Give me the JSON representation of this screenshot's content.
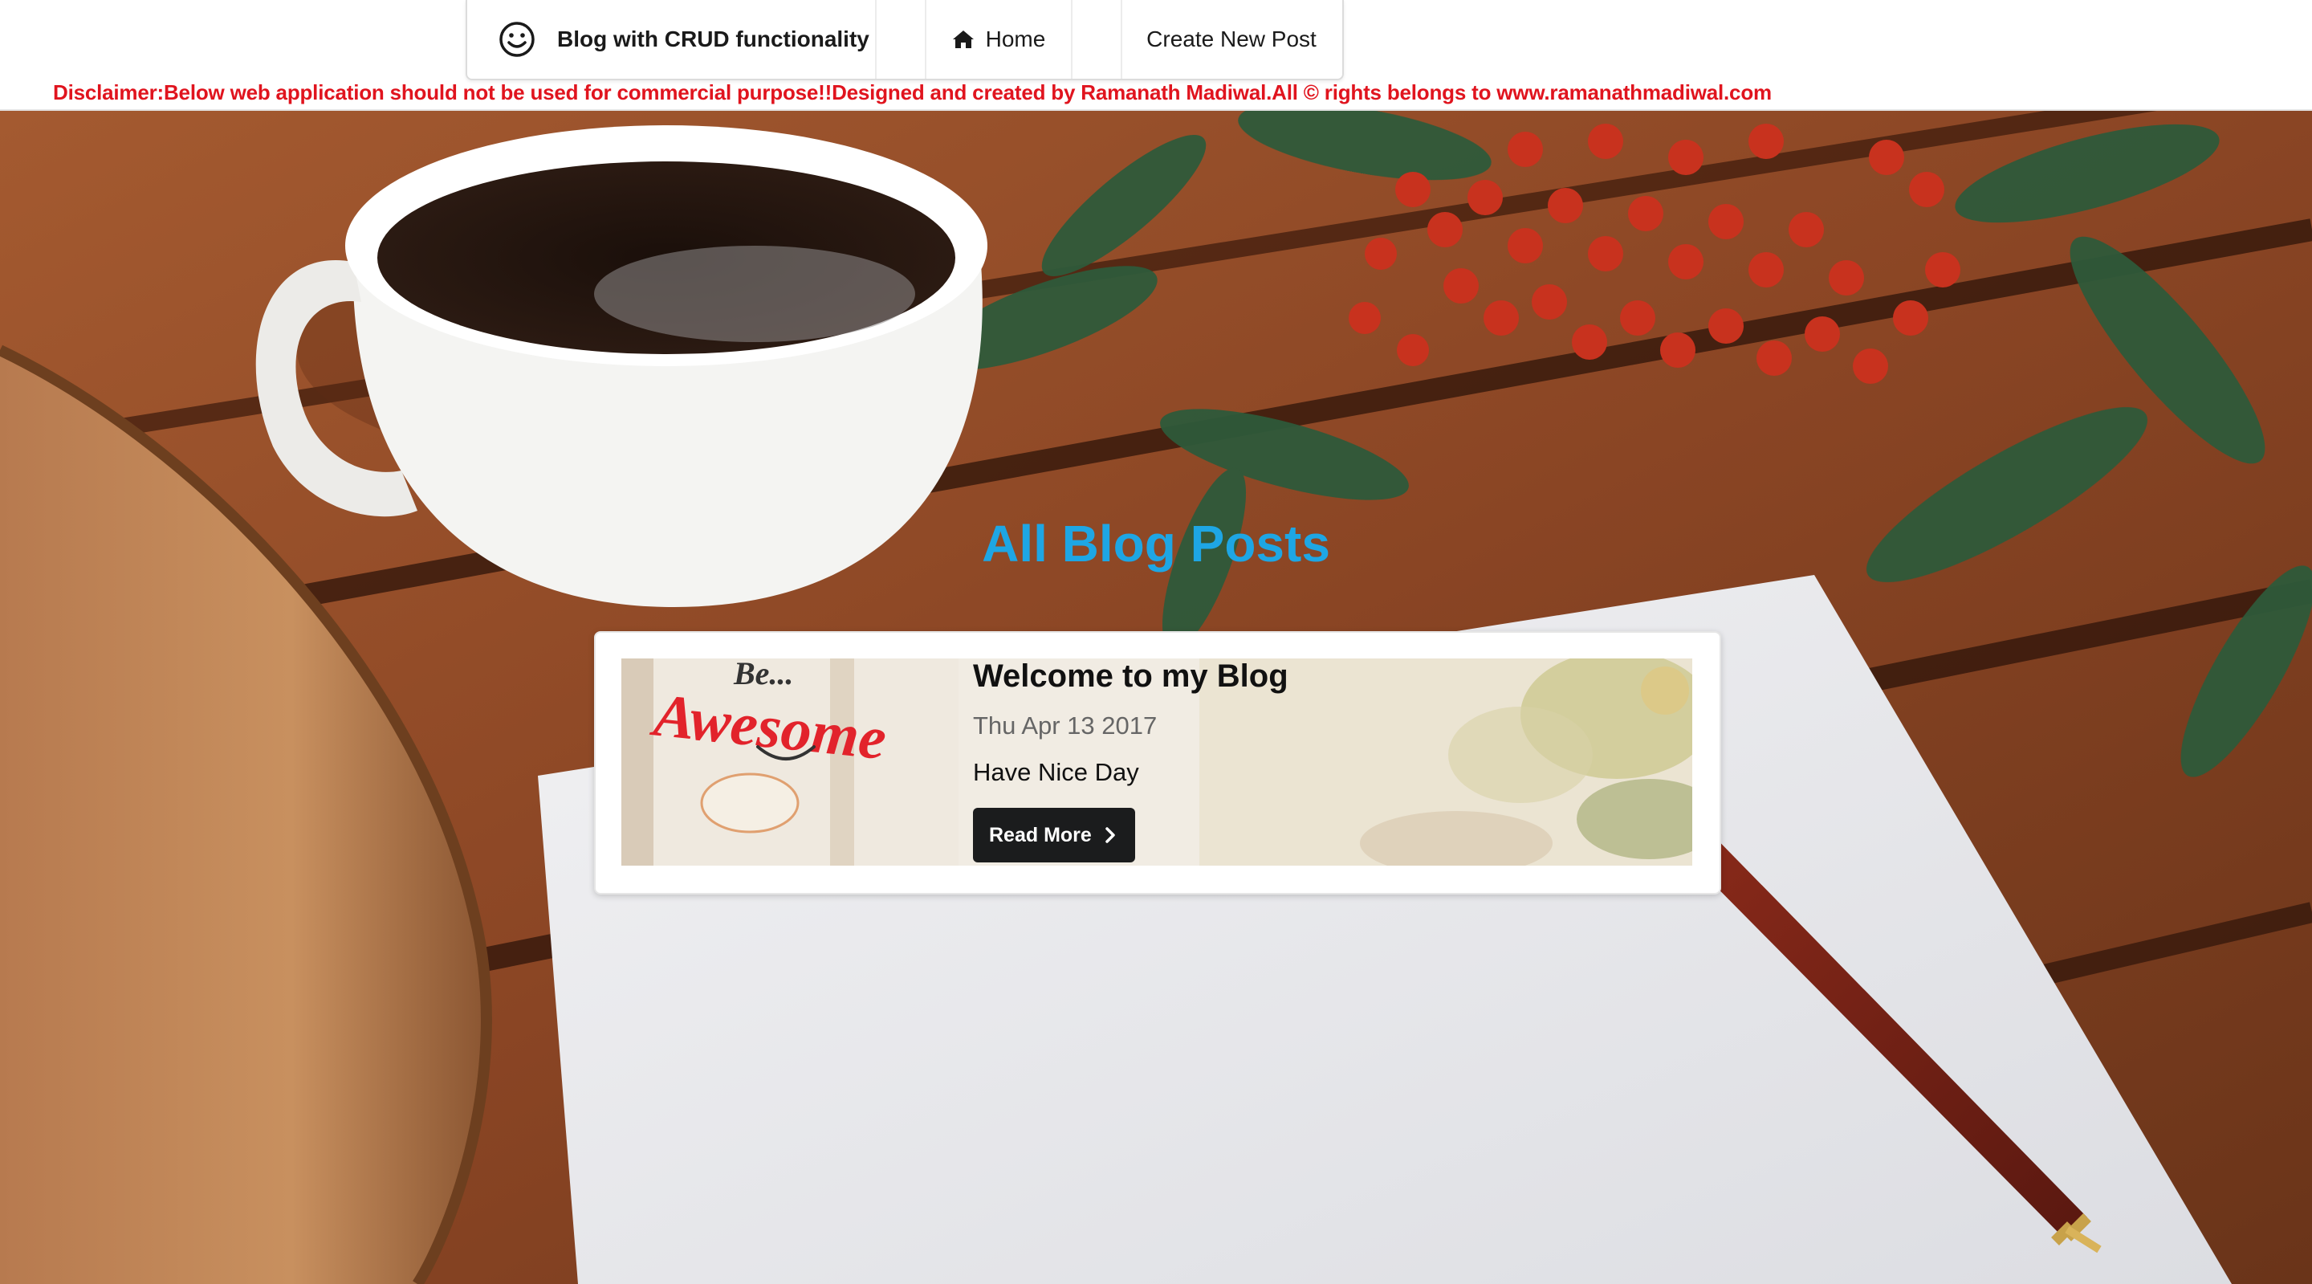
{
  "header": {
    "brand_label": "Blog with CRUD functionality",
    "nav": {
      "home_label": "Home",
      "create_label": "Create New Post"
    },
    "disclaimer": "Disclaimer:Below web application should not be used for commercial purpose!!Designed and created by Ramanath Madiwal.All © rights belongs to www.ramanathmadiwal.com"
  },
  "main": {
    "title": "All Blog Posts",
    "posts": [
      {
        "title": "Welcome to my Blog",
        "date": "Thu Apr 13 2017",
        "description": "Have Nice Day",
        "read_more_label": "Read More",
        "thumbnail_text": {
          "top": "Be...",
          "main": "Awesome"
        }
      }
    ]
  },
  "icons": {
    "brand": "smile-icon",
    "home": "home-icon",
    "read_more": "chevron-right-icon"
  },
  "colors": {
    "title_blue": "#1ea6e4",
    "disclaimer_red": "#e0141e",
    "button_dark": "#1b1c1d"
  }
}
